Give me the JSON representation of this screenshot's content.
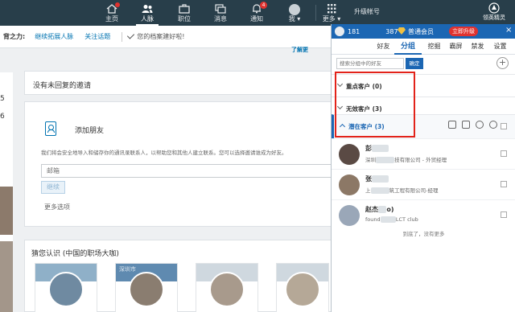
{
  "nav": {
    "items": [
      {
        "label": "主页",
        "icon": "home-icon",
        "badge": "",
        "active": false
      },
      {
        "label": "人脉",
        "icon": "people-icon",
        "badge": "",
        "active": true
      },
      {
        "label": "职位",
        "icon": "briefcase-icon",
        "badge": "",
        "active": false
      },
      {
        "label": "消息",
        "icon": "message-icon",
        "badge": "",
        "active": false
      },
      {
        "label": "通知",
        "icon": "bell-icon",
        "badge": "4",
        "active": false
      },
      {
        "label": "我 ▾",
        "icon": "avatar",
        "badge": "",
        "active": false
      },
      {
        "label": "更多 ▾",
        "icon": "grid-icon",
        "badge": "",
        "active": false
      }
    ],
    "upgrade_account": "升级帐号",
    "elf_label": "领英精灵"
  },
  "notice": {
    "prefix": "背之力:",
    "link1": "继续拓展人脉",
    "link2": "关注话题",
    "done": "您的档案建好啦!"
  },
  "left_numbers": [
    "5",
    "6"
  ],
  "pending": {
    "title": "没有未回复的邀请"
  },
  "add_friend": {
    "title": "添加朋友",
    "description": "我们将会安全地导入和储存你的通讯录联系人，以帮助您和其他人建立联系。您可以选择邀请谁成为好友。",
    "learn_more": "了解更",
    "email_placeholder": "邮箱",
    "continue_label": "继续",
    "more_options": "更多选项"
  },
  "pymk": {
    "title": "猜您认识 (中国的职场大咖)",
    "card_bg_text": "深圳市"
  },
  "panel": {
    "user_id": "181　　　　387",
    "member_label": "普通会员",
    "upgrade_label": "立即升级",
    "close": "×",
    "tabs": [
      "好友",
      "分组",
      "挖掘",
      "霸屏",
      "禁发",
      "设置"
    ],
    "active_tab": "分组",
    "search_placeholder": "搜索分组中的好友",
    "search_ok": "确定",
    "add_label": "+",
    "groups": [
      {
        "label": "重点客户 (0)"
      },
      {
        "label": "无效客户 (3)"
      },
      {
        "label": "潜在客户 (3)"
      }
    ],
    "contacts": [
      {
        "name": "彭",
        "company_a": "深圳",
        "company_b": "技有限公司 - 外贸经理"
      },
      {
        "name": "张",
        "company_a": "上",
        "company_b": "筑工程有限公司-经理"
      },
      {
        "name": "赵杰",
        "name_b": "o)",
        "company_a": "found",
        "company_b": "LCT club"
      }
    ],
    "end_text": "到底了，没有更多"
  }
}
